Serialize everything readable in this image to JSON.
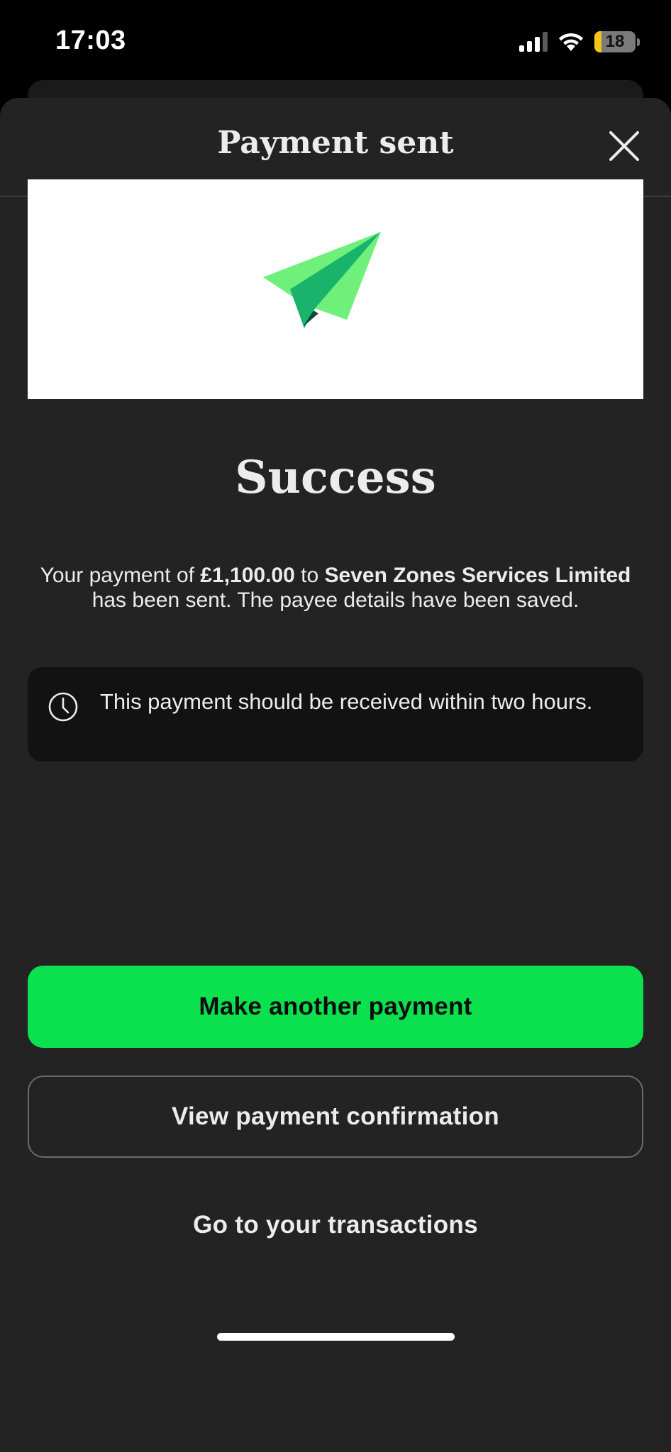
{
  "status_bar": {
    "time": "17:03",
    "battery_level": "18",
    "battery_fraction": 0.18,
    "battery_color": "#f5c518",
    "signal_icon": "cellular-signal-icon",
    "wifi_icon": "wifi-icon"
  },
  "header": {
    "title": "Payment sent",
    "close_icon": "close-icon"
  },
  "illustration": {
    "icon": "paper-plane-icon"
  },
  "success": {
    "heading": "Success",
    "message_prefix": "Your payment of ",
    "amount": "£1,100.00",
    "message_mid": " to ",
    "payee": "Seven Zones Services Limited",
    "message_suffix": " has been sent. The payee details have been saved."
  },
  "info": {
    "icon": "clock-icon",
    "text": "This payment should be received within two hours."
  },
  "actions": {
    "primary_label": "Make another payment",
    "secondary_label": "View payment confirmation",
    "link_label": "Go to your transactions"
  },
  "colors": {
    "accent_green": "#0be04e",
    "sheet_background": "#232323",
    "info_background": "#121212"
  }
}
